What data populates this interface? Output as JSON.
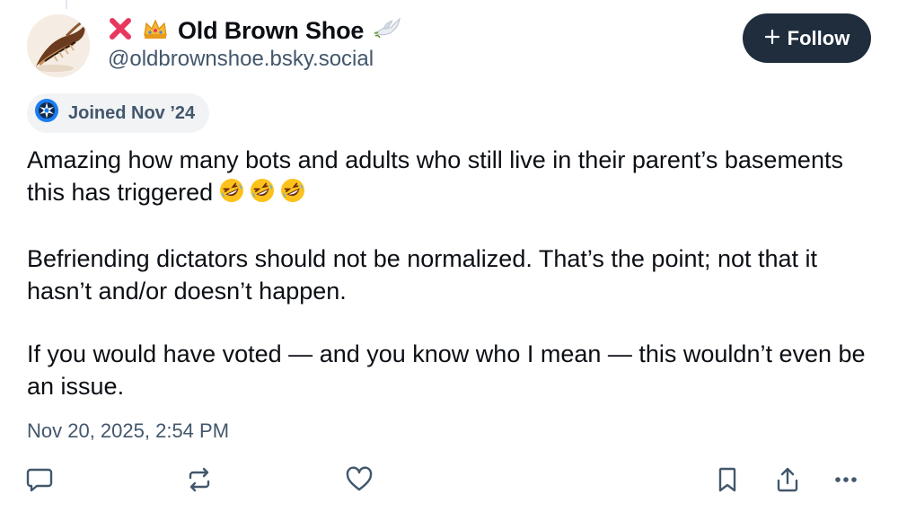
{
  "author": {
    "display_name": "Old Brown Shoe",
    "handle": "@oldbrownshoe.bsky.social",
    "name_prefix_icons": [
      "red-x-icon",
      "crown-icon"
    ],
    "name_suffix_icon": "dove-icon"
  },
  "follow_button": {
    "label": "Follow",
    "icon": "plus-icon"
  },
  "joined_badge": {
    "label": "Joined Nov ’24",
    "icon": "newcomer-badge-icon"
  },
  "post": {
    "paragraphs": [
      "Amazing how many bots and adults who still live in their parent’s basements this has triggered",
      "Befriending dictators should not be normalized.  That’s the point; not that it hasn’t and/or doesn’t happen.",
      "If you would have voted — and you know who I mean — this wouldn’t even be an issue."
    ],
    "paragraph_1_emoji": [
      "rolling-on-floor-laughing-icon",
      "rolling-on-floor-laughing-icon",
      "rolling-on-floor-laughing-icon"
    ],
    "timestamp": "Nov 20, 2025, 2:54 PM"
  },
  "actions": [
    {
      "name": "reply",
      "icon": "reply-bubble-icon"
    },
    {
      "name": "repost",
      "icon": "repost-icon"
    },
    {
      "name": "like",
      "icon": "heart-icon"
    },
    {
      "name": "bookmark",
      "icon": "bookmark-icon"
    },
    {
      "name": "share",
      "icon": "share-icon"
    },
    {
      "name": "more",
      "icon": "more-dots-icon"
    }
  ],
  "colors": {
    "text_primary": "#0b0f14",
    "text_secondary": "#42576c",
    "follow_button_bg": "#1f2d3d",
    "badge_bg": "#f1f3f5",
    "badge_icon_blue": "#1a7cf2",
    "red_x": "#e8385e"
  }
}
